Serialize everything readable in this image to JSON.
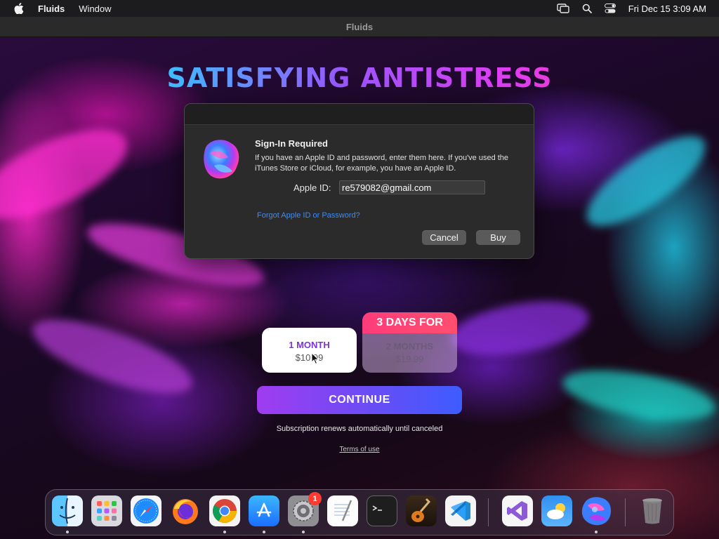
{
  "menubar": {
    "app_name": "Fluids",
    "items": [
      "Window"
    ],
    "clock": "Fri Dec 15  3:09 AM"
  },
  "window": {
    "title": "Fluids"
  },
  "app": {
    "headline": "SATISFYING ANTISTRESS",
    "plans": [
      {
        "name": "1 MONTH",
        "price": "$10.99",
        "selected": true
      },
      {
        "badge": "3 DAYS FOR",
        "name": "2 MONTHS",
        "price": "$19.99",
        "selected": false
      }
    ],
    "continue_label": "CONTINUE",
    "renew_note": "Subscription renews automatically until canceled",
    "terms_label": "Terms of use"
  },
  "sign_in": {
    "title": "Sign-In Required",
    "message": "If you have an Apple ID and password, enter them here. If you've used the iTunes Store or iCloud, for example, you have an Apple ID.",
    "apple_id_label": "Apple ID:",
    "apple_id_value": "re579082@gmail.com",
    "forgot_label": "Forgot Apple ID or Password?",
    "cancel_label": "Cancel",
    "buy_label": "Buy"
  },
  "dock": {
    "apps": [
      "Finder",
      "Launchpad",
      "Safari",
      "Firefox",
      "Chrome",
      "App Store",
      "System Settings",
      "TextEdit",
      "Terminal",
      "GarageBand",
      "Visual Studio Code",
      "Visual Studio",
      "Weather",
      "Fluids",
      "Trash"
    ],
    "settings_badge": "1"
  },
  "colors": {
    "continue_start": "#a03cf0",
    "continue_end": "#3d5cff",
    "promo_badge": "#ff3c7a",
    "link": "#3d8df5"
  }
}
